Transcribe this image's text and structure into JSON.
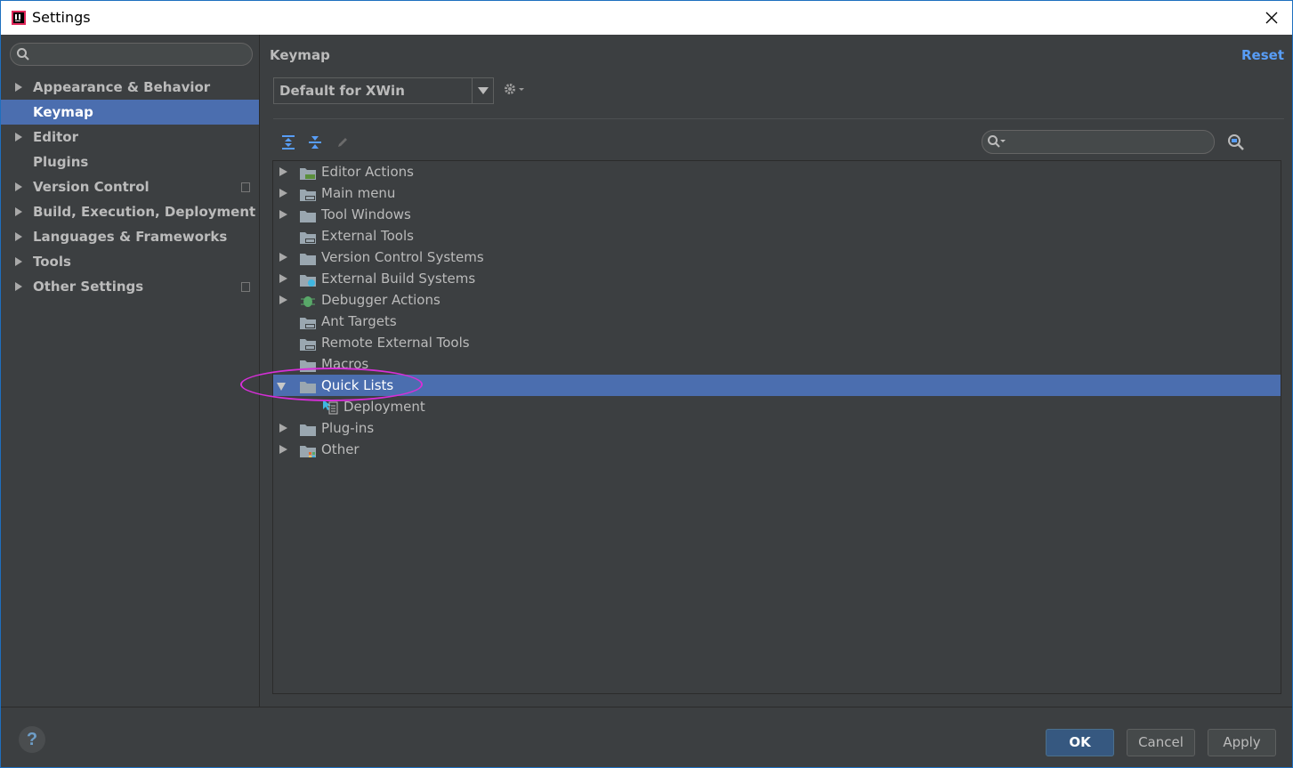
{
  "window": {
    "title": "Settings"
  },
  "sidebar": {
    "search_placeholder": "",
    "items": [
      {
        "label": "Appearance & Behavior",
        "expandable": true
      },
      {
        "label": "Keymap",
        "expandable": false,
        "selected": true
      },
      {
        "label": "Editor",
        "expandable": true
      },
      {
        "label": "Plugins",
        "expandable": false
      },
      {
        "label": "Version Control",
        "expandable": true,
        "project_icon": true
      },
      {
        "label": "Build, Execution, Deployment",
        "expandable": true
      },
      {
        "label": "Languages & Frameworks",
        "expandable": true
      },
      {
        "label": "Tools",
        "expandable": true
      },
      {
        "label": "Other Settings",
        "expandable": true,
        "project_icon": true
      }
    ]
  },
  "content": {
    "title": "Keymap",
    "reset_label": "Reset",
    "keymap_value": "Default for XWin",
    "find_placeholder": ""
  },
  "tree": {
    "items": [
      {
        "label": "Editor Actions",
        "icon": "editor-actions-folder-icon",
        "expanded": false
      },
      {
        "label": "Main menu",
        "icon": "main-menu-folder-icon",
        "expanded": false
      },
      {
        "label": "Tool Windows",
        "icon": "folder-icon",
        "expanded": false
      },
      {
        "label": "External Tools",
        "icon": "external-tools-folder-icon",
        "leaf": true
      },
      {
        "label": "Version Control Systems",
        "icon": "folder-icon",
        "expanded": false
      },
      {
        "label": "External Build Systems",
        "icon": "external-build-folder-icon",
        "expanded": false
      },
      {
        "label": "Debugger Actions",
        "icon": "debugger-bug-icon",
        "expanded": false
      },
      {
        "label": "Ant Targets",
        "icon": "ant-folder-icon",
        "leaf": true
      },
      {
        "label": "Remote External Tools",
        "icon": "remote-tools-folder-icon",
        "leaf": true
      },
      {
        "label": "Macros",
        "icon": "folder-icon",
        "leaf": true
      },
      {
        "label": "Quick Lists",
        "icon": "folder-icon",
        "expanded": true,
        "selected": true
      },
      {
        "label": "Deployment",
        "icon": "quick-list-icon",
        "child": true
      },
      {
        "label": "Plug-ins",
        "icon": "folder-icon",
        "expanded": false
      },
      {
        "label": "Other",
        "icon": "other-folder-icon",
        "expanded": false
      }
    ]
  },
  "footer": {
    "help_label": "?",
    "ok_label": "OK",
    "cancel_label": "Cancel",
    "apply_label": "Apply"
  },
  "colors": {
    "background": "#3c3f41",
    "selection": "#4b6eaf",
    "link": "#589df6",
    "annotation": "#d62fd8"
  }
}
